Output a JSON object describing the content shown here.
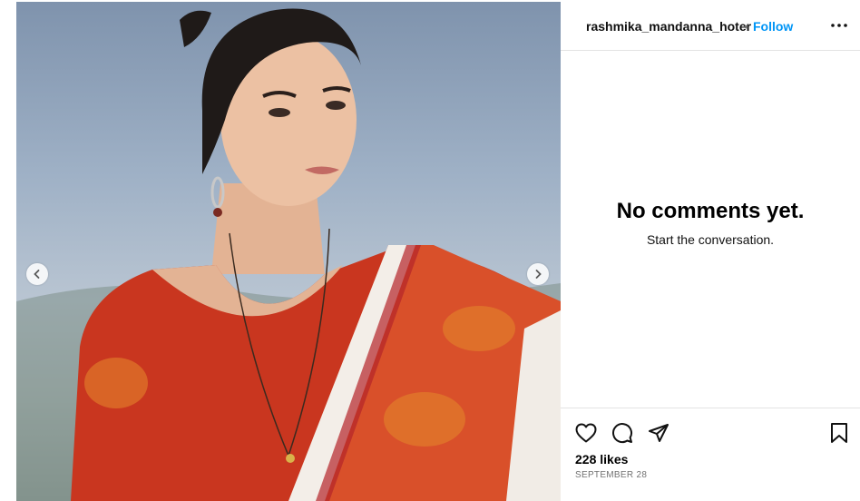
{
  "post": {
    "username": "rashmika_mandanna_hoter",
    "separator": "•",
    "follow_label": "Follow",
    "more_icon": "more-options-icon"
  },
  "comments": {
    "empty_title": "No comments yet.",
    "empty_subtitle": "Start the conversation."
  },
  "actions": {
    "like_icon": "heart-icon",
    "comment_icon": "comment-icon",
    "share_icon": "share-icon",
    "save_icon": "bookmark-icon",
    "likes_text": "228 likes",
    "date": "SEPTEMBER 28"
  },
  "carousel": {
    "prev_icon": "chevron-left-icon",
    "next_icon": "chevron-right-icon"
  },
  "colors": {
    "follow": "#0095f6",
    "saree_red": "#c9361f",
    "saree_orange": "#e0772a",
    "divider": "#e3e3e3"
  }
}
